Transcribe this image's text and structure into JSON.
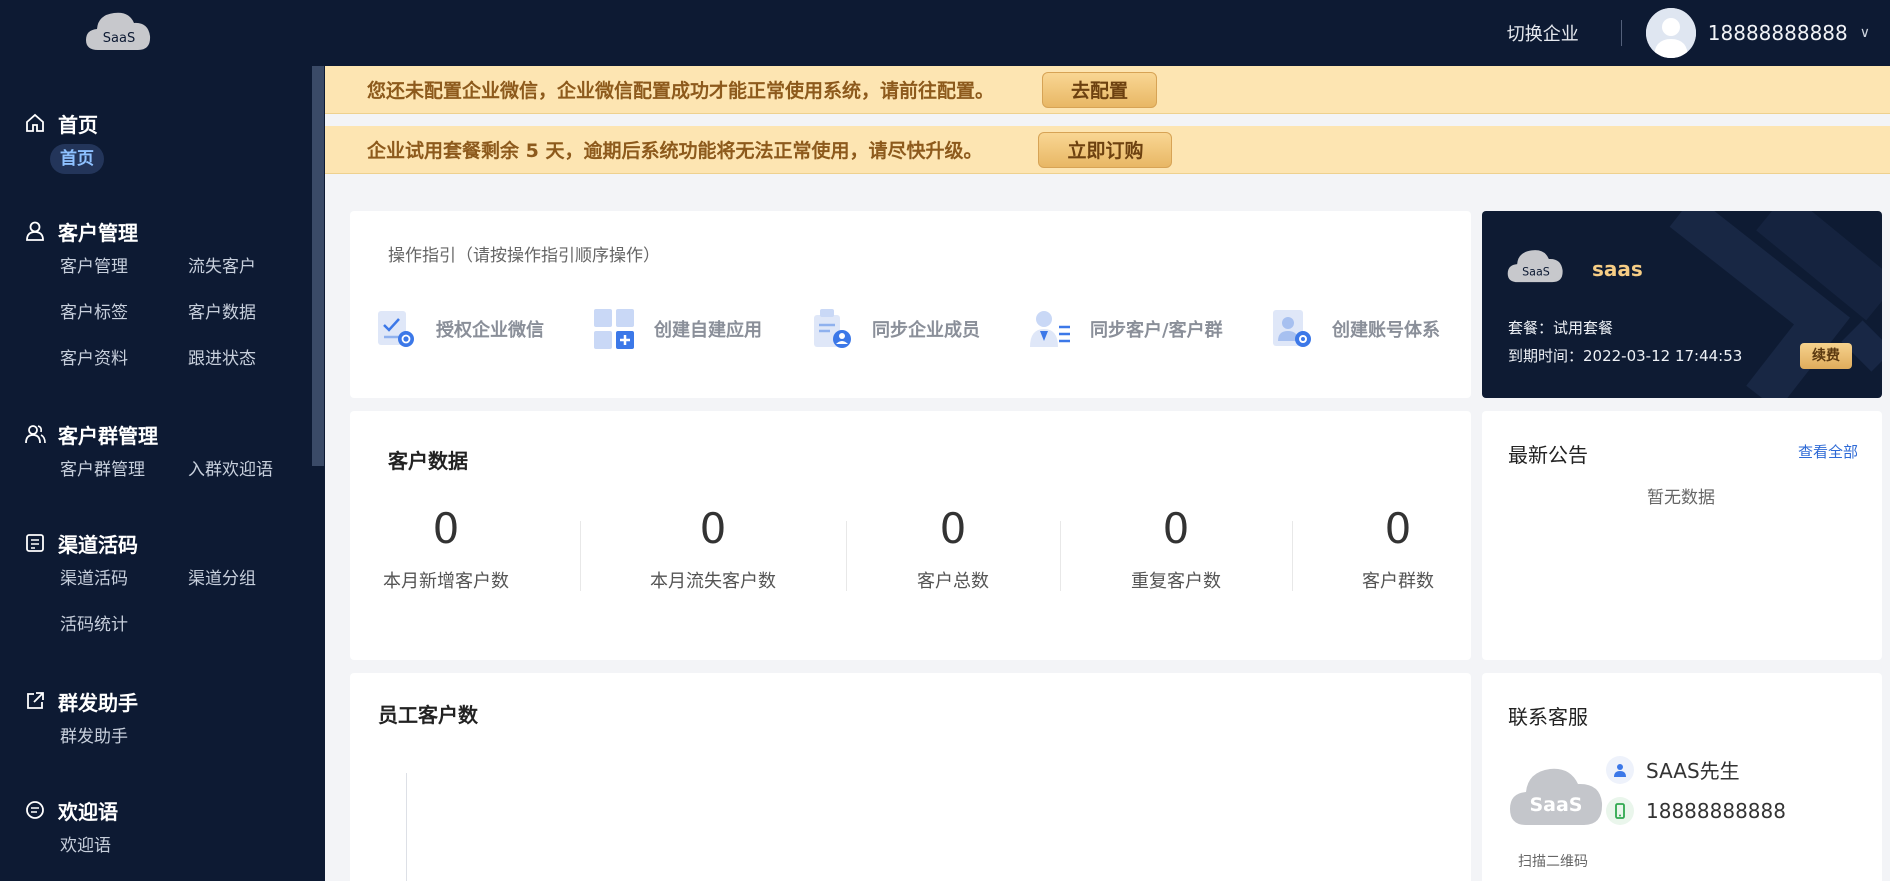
{
  "topbar": {
    "logo_text": "SaaS",
    "switch_enterprise": "切换企业",
    "user_phone": "18888888888"
  },
  "sidebar": {
    "groups": [
      {
        "title": "首页",
        "icon": "home-icon",
        "items": [
          "首页"
        ],
        "active": "首页"
      },
      {
        "title": "客户管理",
        "icon": "user-icon",
        "items": [
          "客户管理",
          "流失客户",
          "客户标签",
          "客户数据",
          "客户资料",
          "跟进状态"
        ]
      },
      {
        "title": "客户群管理",
        "icon": "group-icon",
        "items": [
          "客户群管理",
          "入群欢迎语"
        ]
      },
      {
        "title": "渠道活码",
        "icon": "qr-icon",
        "items": [
          "渠道活码",
          "渠道分组",
          "活码统计"
        ]
      },
      {
        "title": "群发助手",
        "icon": "share-icon",
        "items": [
          "群发助手"
        ]
      },
      {
        "title": "欢迎语",
        "icon": "message-icon",
        "items": [
          "欢迎语"
        ]
      }
    ]
  },
  "banners": [
    {
      "text": "您还未配置企业微信，企业微信配置成功才能正常使用系统，请前往配置。",
      "button": "去配置"
    },
    {
      "text": "企业试用套餐剩余 5 天，逾期后系统功能将无法正常使用，请尽快升级。",
      "button": "立即订购"
    }
  ],
  "guide": {
    "title": "操作指引（请按操作指引顺序操作）",
    "steps": [
      "授权企业微信",
      "创建自建应用",
      "同步企业成员",
      "同步客户/客户群",
      "创建账号体系"
    ]
  },
  "package": {
    "logo_text": "SaaS",
    "name": "saas",
    "plan": "套餐：试用套餐",
    "expire": "到期时间：2022-03-12 17:44:53",
    "renew_button": "续费"
  },
  "customer_data": {
    "title": "客户数据",
    "stats": [
      {
        "value": "0",
        "label": "本月新增客户数"
      },
      {
        "value": "0",
        "label": "本月流失客户数"
      },
      {
        "value": "0",
        "label": "客户总数"
      },
      {
        "value": "0",
        "label": "重复客户数"
      },
      {
        "value": "0",
        "label": "客户群数"
      }
    ]
  },
  "announcement": {
    "title": "最新公告",
    "view_all": "查看全部",
    "empty": "暂无数据"
  },
  "employee": {
    "title": "员工客户数"
  },
  "service": {
    "title": "联系客服",
    "logo_text": "SaaS",
    "name": "SAAS先生",
    "phone": "18888888888",
    "qr_label": "扫描二维码"
  },
  "colors": {
    "nav_bg": "#0d1a33",
    "banner_bg": "#fde5b2",
    "accent_gold": "#e8b765",
    "link": "#2e6ad6"
  }
}
